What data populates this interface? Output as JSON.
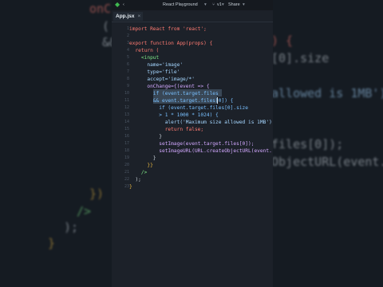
{
  "window": {
    "app_icon": "diamond-logo-icon",
    "project_name": "React Playground",
    "branch": "v1",
    "share_label": "Share"
  },
  "tab": {
    "filename": "App.jsx",
    "close_glyph": "×"
  },
  "gutter_numbers": [
    "1",
    "2",
    "3",
    "4",
    "5",
    "6",
    "7",
    "8",
    "9",
    "10",
    "11",
    "12",
    "13",
    "14",
    "15",
    "16",
    "17",
    "18",
    "19",
    "20",
    "21",
    "22",
    "23"
  ],
  "code_lines": [
    "import React from 'react';",
    "",
    "export function App(props) {",
    "  return (",
    "    <input",
    "      name='image'",
    "      type='file'",
    "      accept='image/*'",
    "      onChange={(event => {",
    "        if (event.target.files",
    "        && event.target.files[0]) {",
    "          if (event.target.files[0].size",
    "          > 1 * 1000 * 1024) {",
    "            alert('Maximum size allowed is 1MB')",
    "            return false;",
    "          }",
    "          setImage(event.target.files[0]);",
    "          setImageURL(URL.createObjectURL(event.",
    "        }",
    "      }}",
    "    />",
    "  );",
    "}"
  ],
  "background_lines": [
    "onC",
    "(",
    "&&",
    ") {",
    "[0].size",
    "allowed is 1MB')",
    "files[0]);",
    "ObjectURL(event.",
    "})",
    "/>",
    ");",
    "}"
  ],
  "colors": {
    "editor_bg": "#1c2129",
    "selection": "#394756",
    "keyword": "#ff7b72",
    "string": "#a5d6ff",
    "tag": "#7ee787"
  }
}
